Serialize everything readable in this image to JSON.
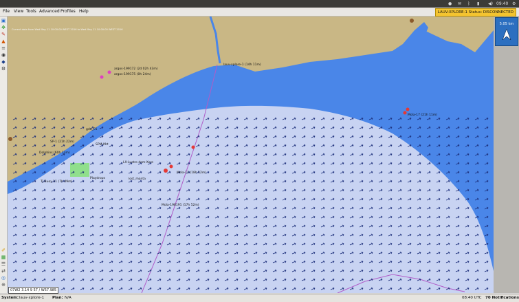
{
  "system_tray": {
    "time": "09:40"
  },
  "menu": {
    "items": [
      "File",
      "View",
      "Tools",
      "Advanced",
      "Profiles",
      "Help"
    ]
  },
  "connection_status": "LAUV-XPLORE-1  Status: DISCONNECTED",
  "map": {
    "timestamp_caption": "Current data from Wed May 11 10:00:00 WEST 2016 to Wed May 11 10:00:00 WEST 2016",
    "labels": {
      "argos1": "argos-199172 (2d 02h 43m)",
      "argos2": "argos-199175 (0h 24m)",
      "vehicle_coast": "lauv-xplore-1 (14h 11m)",
      "mola_east": "Mola-17 (21h 11m)",
      "mola_center": "Mola-11 (18h 12m)",
      "mola_south": "Mola-198191 (17h 52m)",
      "dolphin": "Dolphins (60h 13m)",
      "lost": "lost_manta",
      "sp1": "SP-1 (21h 22m)",
      "gdu": "gdu_01",
      "spm": "SPM-Mrt",
      "lowtide": "LX-Lustro dom-Xore",
      "playdrops": "Playdrops",
      "buoy": "TJ Buoy 11 (7h 49m)",
      "fine": "fine_play_01"
    }
  },
  "scale": {
    "text": "5.05 km"
  },
  "coordinates": "07W2 3.14 9 57 / W57.985",
  "status_bar": {
    "system_label": "System:",
    "system_value": "lauv-xplore-1",
    "plan_label": "Plan:",
    "plan_value": "N/A",
    "utc_time": "08:40 UTC",
    "notifications": "70 Notifications"
  },
  "colors": {
    "land": "#c9b785",
    "deep_water": "#4a86e8",
    "shallow_water": "#c8d3f2",
    "arrows": "#1c2e7a",
    "status_warning": "#f4c430"
  }
}
